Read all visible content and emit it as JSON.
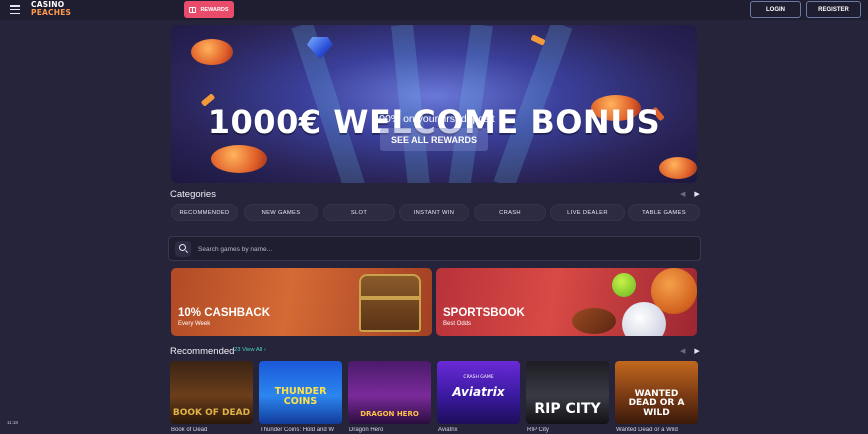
{
  "header": {
    "logo_line1": "CASINO",
    "logo_line2": "PEACHES",
    "rewards_label": "REWARDS",
    "login_label": "LOGIN",
    "register_label": "REGISTER"
  },
  "hero": {
    "title": "1000€ WELCOME BONUS",
    "subtitle": "100% on your first deposit",
    "button_label": "SEE ALL REWARDS"
  },
  "categories": {
    "title": "Categories",
    "items": [
      "RECOMMENDED",
      "NEW GAMES",
      "SLOT",
      "INSTANT WIN",
      "CRASH",
      "LIVE DEALER",
      "TABLE GAMES"
    ]
  },
  "search": {
    "placeholder": "Search games by name..."
  },
  "promos": [
    {
      "title": "10% CASHBACK",
      "subtitle": "Every Week"
    },
    {
      "title": "SPORTSBOOK",
      "subtitle": "Best Odds"
    }
  ],
  "recommended": {
    "title": "Recommended",
    "count": "23",
    "view_all": "View All",
    "games": [
      {
        "art": "BOOK OF DEAD",
        "name": "Book of Dead"
      },
      {
        "art": "THUNDER COINS",
        "name": "Thunder Coins: Hold and W"
      },
      {
        "art": "DRAGON HERO",
        "name": "Dragon Hero"
      },
      {
        "art": "Aviatrix",
        "tag": "CRASH GAME",
        "name": "Aviatrix"
      },
      {
        "art": "RIP CITY",
        "name": "RIP City"
      },
      {
        "art": "WANTED DEAD OR A WILD",
        "name": "Wanted Dead or a Wild"
      }
    ]
  },
  "status": {
    "time": "11:18"
  },
  "colors": {
    "background": "#26243a",
    "rewards": "#e94b6a",
    "accent_link": "#4fd1c5"
  }
}
